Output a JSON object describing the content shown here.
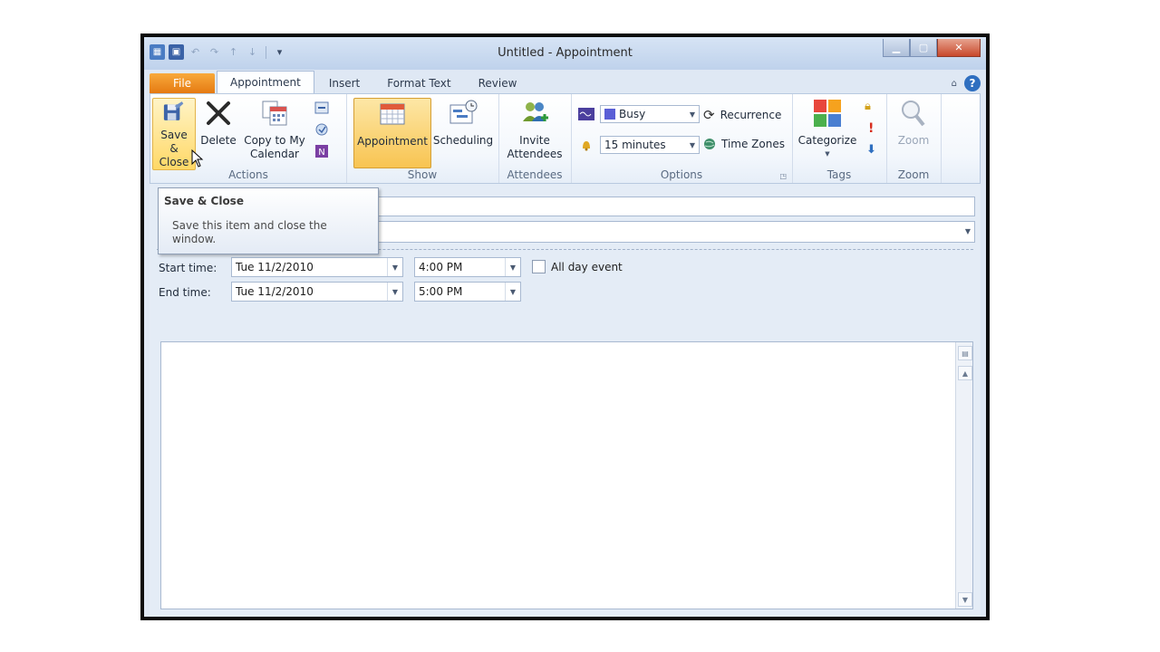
{
  "window": {
    "title": "Untitled - Appointment",
    "minimize": "▁",
    "maximize": "▢",
    "close": "✕"
  },
  "tabs": [
    "File",
    "Appointment",
    "Insert",
    "Format Text",
    "Review"
  ],
  "active_tab": "Appointment",
  "help": "?",
  "ribbon": {
    "actions": {
      "label": "Actions",
      "save_close": "Save & Close",
      "delete": "Delete",
      "copy_to_calendar": "Copy to My Calendar"
    },
    "show": {
      "label": "Show",
      "appointment": "Appointment",
      "scheduling": "Scheduling"
    },
    "attendees": {
      "label": "Attendees",
      "invite": "Invite Attendees"
    },
    "options": {
      "label": "Options",
      "show_as": "Busy",
      "reminder": "15 minutes",
      "recurrence": "Recurrence",
      "time_zones": "Time Zones"
    },
    "tags": {
      "label": "Tags",
      "categorize": "Categorize"
    },
    "zoom": {
      "label": "Zoom",
      "zoom": "Zoom"
    }
  },
  "tooltip": {
    "title": "Save & Close",
    "description": "Save this item and close the window."
  },
  "form": {
    "start_label": "Start time:",
    "start_date": "Tue 11/2/2010",
    "start_time": "4:00 PM",
    "end_label": "End time:",
    "end_date": "Tue 11/2/2010",
    "end_time": "5:00 PM",
    "all_day": "All day event"
  },
  "colors": {
    "file_tab": "#e57a12",
    "selected_button": "#f8c451",
    "ribbon_bg": "#f3f7fc",
    "frame_border": "#0b0b0b"
  }
}
